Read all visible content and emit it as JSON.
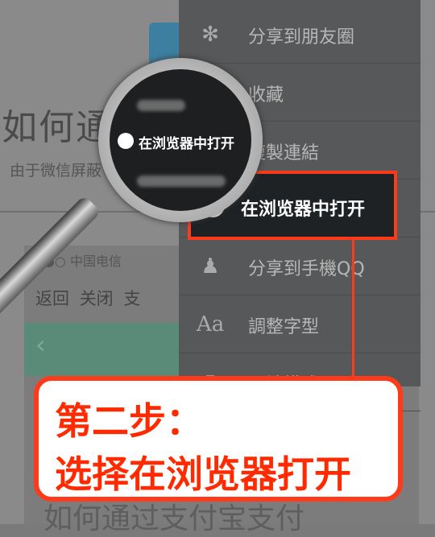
{
  "background": {
    "title": "如何通",
    "subtitle": "由于微信屏蔽",
    "phone": {
      "carrier": "中国电信",
      "nav_back": "返回",
      "nav_close": "关闭",
      "nav_more": "支",
      "bottom_text": "如何通过支付宝支付"
    }
  },
  "menu": {
    "items": [
      {
        "label": "分享到朋友圈",
        "icon": "camera-shutter-icon"
      },
      {
        "label": "收藏",
        "icon": "star-icon"
      },
      {
        "label": "複製連結",
        "icon": "link-icon"
      },
      {
        "label": "在浏览器中打开",
        "icon": "globe-icon"
      },
      {
        "label": "分享到手機QQ",
        "icon": "qq-penguin-icon"
      },
      {
        "label": "調整字型",
        "icon": "font-size-icon"
      },
      {
        "label": "閱讀模式",
        "icon": "book-icon"
      }
    ]
  },
  "magnifier": {
    "label": "在浏览器中打开"
  },
  "callout": {
    "line1": "第二步：",
    "line2": "选择在浏览器打开"
  },
  "colors": {
    "accent": "#ff3a1a",
    "menu_bg": "#575859",
    "highlight_bg": "#1f2224"
  }
}
